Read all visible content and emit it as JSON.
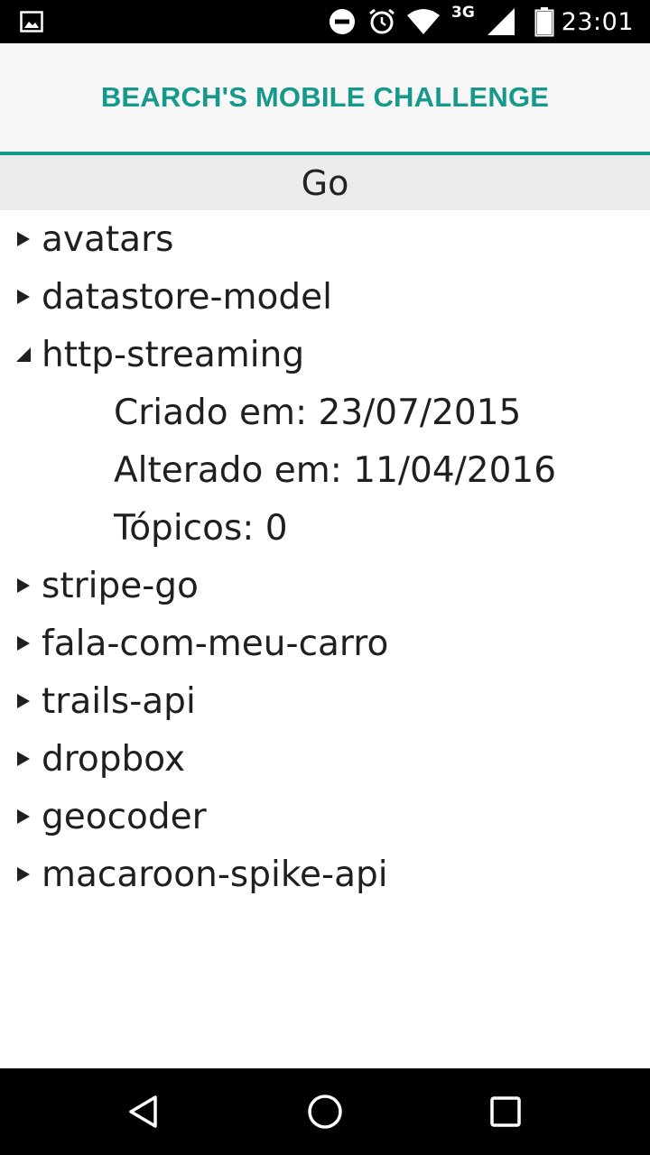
{
  "status_bar": {
    "time": "23:01",
    "network": "3G",
    "icons": [
      "image-notification-icon",
      "do-not-disturb-icon",
      "alarm-icon",
      "wifi-icon",
      "cell-signal-icon",
      "battery-icon"
    ]
  },
  "app_bar": {
    "title": "BEARCH'S MOBILE CHALLENGE",
    "accent_color": "#14998a"
  },
  "group": {
    "title": "Go"
  },
  "tree": {
    "items": [
      {
        "label": "avatars",
        "expanded": false
      },
      {
        "label": "datastore-model",
        "expanded": false
      },
      {
        "label": "http-streaming",
        "expanded": true,
        "details": [
          "Criado em: 23/07/2015",
          "Alterado em: 11/04/2016",
          "Tópicos: 0"
        ]
      },
      {
        "label": "stripe-go",
        "expanded": false
      },
      {
        "label": "fala-com-meu-carro",
        "expanded": false
      },
      {
        "label": "trails-api",
        "expanded": false
      },
      {
        "label": "dropbox",
        "expanded": false
      },
      {
        "label": "geocoder",
        "expanded": false
      },
      {
        "label": "macaroon-spike-api",
        "expanded": false
      }
    ]
  },
  "nav_bar": {
    "icons": [
      "back-icon",
      "home-icon",
      "recents-icon"
    ]
  }
}
